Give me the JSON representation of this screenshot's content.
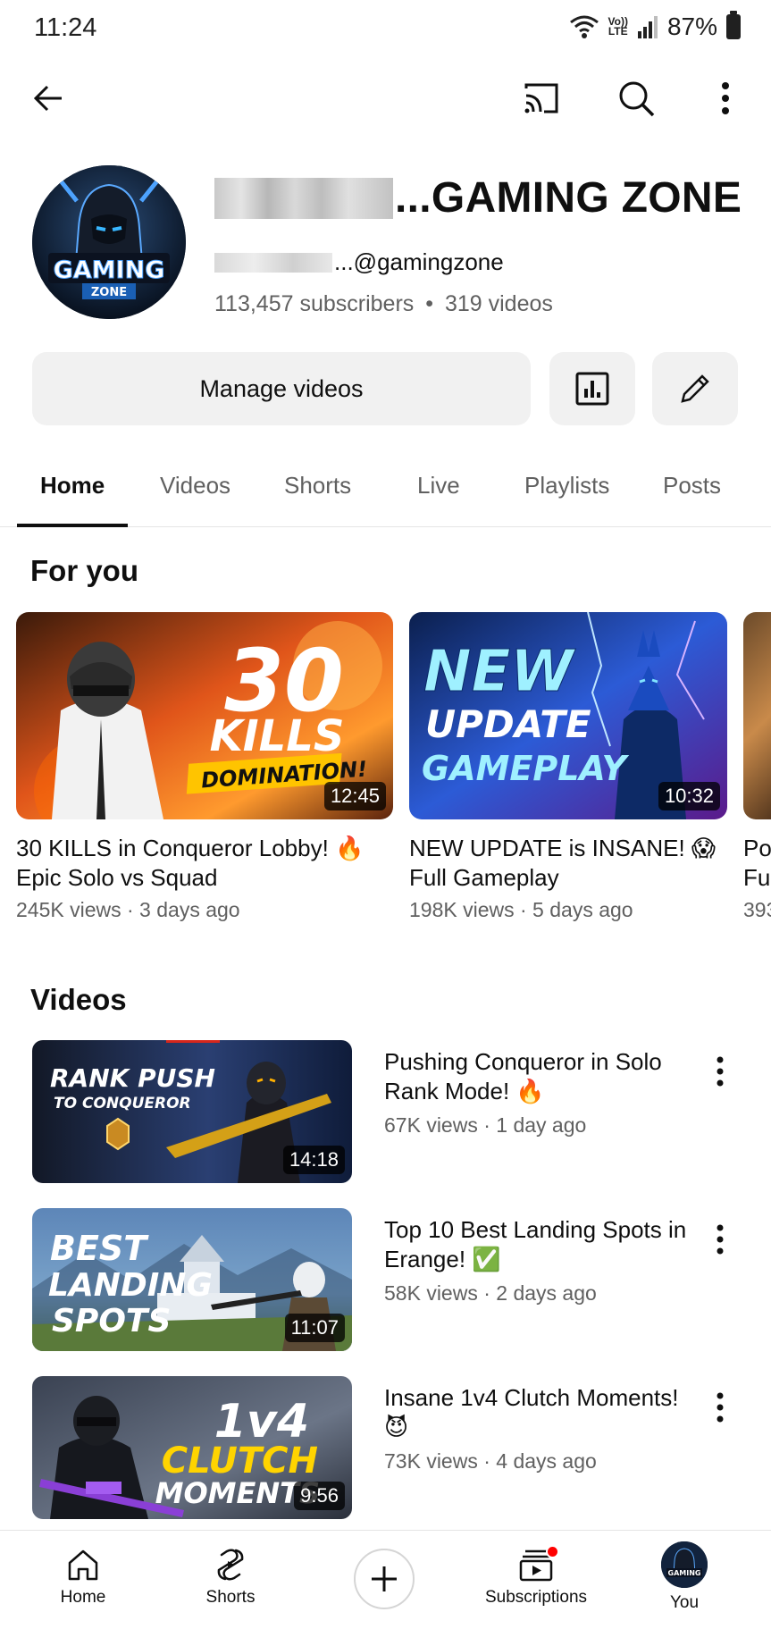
{
  "status_bar": {
    "time": "11:24",
    "battery": "87%",
    "lte_top": "Vo))",
    "lte_bottom": "LTE"
  },
  "channel": {
    "name_visible": "...GAMING ZONE",
    "handle_visible": "...@gamingzone",
    "subscribers": "113,457 subscribers",
    "separator": "•",
    "videos": "319 videos",
    "avatar_text_top": "GAMING",
    "avatar_text_bottom": "ZONE"
  },
  "actions": {
    "manage_label": "Manage videos"
  },
  "tabs": [
    {
      "label": "Home",
      "active": true
    },
    {
      "label": "Videos"
    },
    {
      "label": "Shorts"
    },
    {
      "label": "Live"
    },
    {
      "label": "Playlists"
    },
    {
      "label": "Posts"
    }
  ],
  "for_you": {
    "title": "For you",
    "items": [
      {
        "title": "30 KILLS in Conqueror Lobby! 🔥 Epic Solo vs Squad",
        "meta": "245K views · 3 days ago",
        "duration": "12:45",
        "thumb_lines": [
          "30",
          "KILLS",
          "DOMINATION!"
        ]
      },
      {
        "title": "NEW UPDATE is INSANE! 😱 Full Gameplay",
        "meta": "198K views · 5 days ago",
        "duration": "10:32",
        "thumb_lines": [
          "NEW",
          "UPDATE",
          "GAMEPLAY"
        ]
      },
      {
        "title": "Po Fu",
        "meta": "393"
      }
    ]
  },
  "videos_section": {
    "title": "Videos",
    "items": [
      {
        "title": "Pushing Conqueror in Solo Rank Mode! 🔥",
        "meta": "67K views · 1 day ago",
        "duration": "14:18",
        "thumb_lines": [
          "RANK PUSH",
          "TO CONQUEROR"
        ]
      },
      {
        "title": "Top 10 Best Landing Spots in Erange! ✅",
        "meta": "58K views · 2 days ago",
        "duration": "11:07",
        "thumb_lines": [
          "BEST",
          "LANDING",
          "SPOTS"
        ]
      },
      {
        "title": "Insane 1v4 Clutch Moments! 😈",
        "meta": "73K views · 4 days ago",
        "duration": "9:56",
        "thumb_lines": [
          "1v4",
          "CLUTCH",
          "MOMENTS"
        ]
      }
    ]
  },
  "bottom_nav": {
    "home": "Home",
    "shorts": "Shorts",
    "subscriptions": "Subscriptions",
    "you": "You"
  },
  "icons": [
    "back-icon",
    "cast-icon",
    "search-icon",
    "more-vert-icon",
    "analytics-icon",
    "edit-pencil-icon",
    "home-icon",
    "shorts-icon",
    "create-plus-icon",
    "subscriptions-icon"
  ],
  "colors": {
    "accent_red": "#ff0000",
    "chip_bg": "#f1f1f1",
    "secondary_text": "#606060"
  }
}
